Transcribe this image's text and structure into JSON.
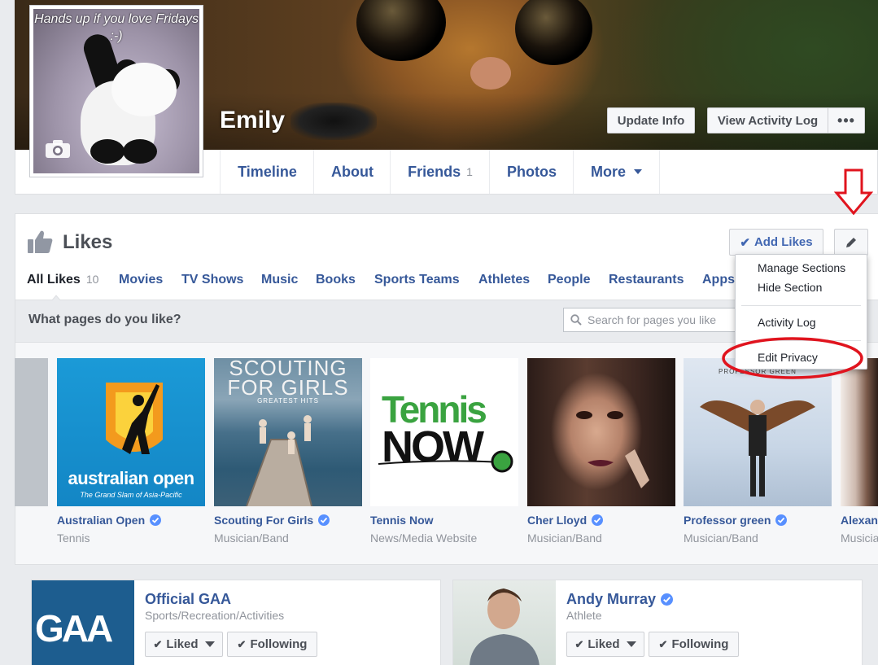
{
  "profile": {
    "picture_caption": "Hands up if you love Fridays :-)",
    "name": "Emily"
  },
  "header_buttons": {
    "update_info": "Update Info",
    "view_activity_log": "View Activity Log",
    "more": "•••"
  },
  "timeline_tabs": [
    {
      "label": "Timeline"
    },
    {
      "label": "About"
    },
    {
      "label": "Friends",
      "count": "1"
    },
    {
      "label": "Photos"
    },
    {
      "label": "More"
    }
  ],
  "likes": {
    "title": "Likes",
    "add_likes": "Add Likes",
    "tabs": [
      {
        "label": "All Likes",
        "count": "10"
      },
      {
        "label": "Movies"
      },
      {
        "label": "TV Shows"
      },
      {
        "label": "Music"
      },
      {
        "label": "Books"
      },
      {
        "label": "Sports Teams"
      },
      {
        "label": "Athletes"
      },
      {
        "label": "People"
      },
      {
        "label": "Restaurants"
      },
      {
        "label": "Apps"
      }
    ],
    "search_question": "What pages do you like?",
    "search_placeholder": "Search for pages you like"
  },
  "menu": {
    "items": [
      "Manage Sections",
      "Hide Section",
      "Activity Log",
      "Edit Privacy"
    ]
  },
  "liked_pages": [
    {
      "name": "Australian Open",
      "category": "Tennis",
      "verified": true,
      "art_title": "australian open",
      "art_subtitle": "The Grand Slam of Asia-Pacific"
    },
    {
      "name": "Scouting For Girls",
      "category": "Musician/Band",
      "verified": true,
      "art_title": "SCOUTING FOR GIRLS",
      "art_subtitle": "GREATEST HITS"
    },
    {
      "name": "Tennis Now",
      "category": "News/Media Website",
      "verified": false,
      "art_line1": "Tennis",
      "art_line2": "NOW"
    },
    {
      "name": "Cher Lloyd",
      "category": "Musician/Band",
      "verified": true
    },
    {
      "name": "Professor green",
      "category": "Musician/Band",
      "verified": true,
      "art_title": "PROFESSOR GREEN"
    },
    {
      "name": "Alexan",
      "category": "Musicia",
      "verified": false
    }
  ],
  "page_cards": [
    {
      "name": "Official GAA",
      "category": "Sports/Recreation/Activities",
      "verified": false,
      "liked": "Liked",
      "following": "Following",
      "logo_text": "GAA"
    },
    {
      "name": "Andy Murray",
      "category": "Athlete",
      "verified": true,
      "liked": "Liked",
      "following": "Following"
    }
  ],
  "colors": {
    "link_blue": "#365899",
    "brand_blue": "#4267b2",
    "annotation_red": "#e0141e",
    "verified_blue": "#5890ff"
  }
}
